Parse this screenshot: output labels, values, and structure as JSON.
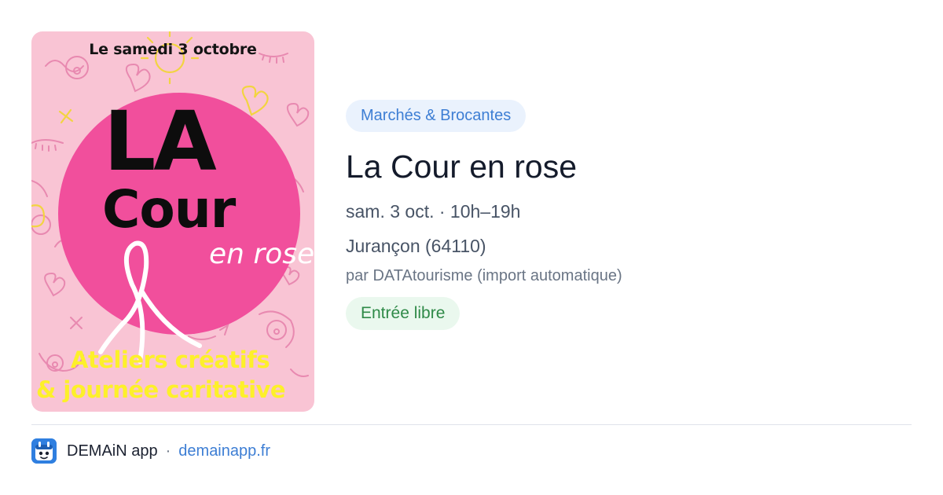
{
  "poster": {
    "date_line": "Le samedi 3 octobre",
    "title_line1": "LA",
    "title_line2": "Cour",
    "title_line3": "en rose",
    "tagline1": "Ateliers créatifs",
    "tagline2": "& journée caritative",
    "colors": {
      "background": "#f9c4d4",
      "circle": "#f14f9c",
      "tagline": "#fdf02a"
    }
  },
  "event": {
    "category": "Marchés & Brocantes",
    "title": "La Cour en rose",
    "when": "sam. 3 oct. · 10h–19h",
    "where": "Jurançon (64110)",
    "source": "par DATAtourisme (import automatique)",
    "price": "Entrée libre"
  },
  "footer": {
    "app_name": "DEMAiN app",
    "separator": "·",
    "link": "demainapp.fr"
  },
  "colors": {
    "accent": "#3d7ed4",
    "chip_bg": "#eaf2fd",
    "price_bg": "#eaf8ee",
    "price_text": "#2f8a48"
  }
}
